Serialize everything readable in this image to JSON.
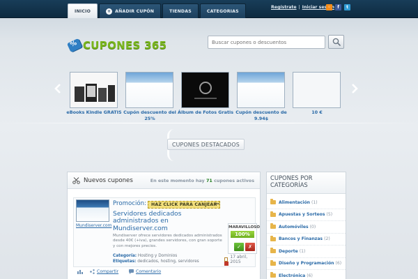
{
  "nav": {
    "items": [
      {
        "label": "INICIO"
      },
      {
        "label": "AÑADIR CUPÓN",
        "badge": "+"
      },
      {
        "label": "TIENDAS"
      },
      {
        "label": "CATEGORIAS"
      }
    ]
  },
  "user_links": {
    "register": "Regístrate",
    "separator": "|",
    "login": "Iniciar sesión"
  },
  "social": [
    {
      "icon": "rss-icon",
      "glyph": "◦",
      "color": "#f28c1a"
    },
    {
      "icon": "facebook-icon",
      "glyph": "f",
      "color": "#3b5998"
    },
    {
      "icon": "twitter-icon",
      "glyph": "t",
      "color": "#2f9bd4"
    }
  ],
  "logo": {
    "text": "CUPONES 365"
  },
  "search": {
    "placeholder": "Buscar cupones o descuentos"
  },
  "carousel": {
    "items": [
      {
        "caption": "eBooks Kindle GRATIS",
        "style": "t-kindle"
      },
      {
        "caption": "Cupón descuento del 25%",
        "style": "t-host"
      },
      {
        "caption": "Álbum de Fotos Gratis",
        "style": "t-wp"
      },
      {
        "caption": "Cupón descuento de 9.94$",
        "style": "t-host"
      },
      {
        "caption": "10 €",
        "style": "t-blank"
      }
    ]
  },
  "featured_label": "CUPONES DESTACADOS",
  "main": {
    "title": "Nuevos cupones",
    "count_prefix": "En este momento hay",
    "count": "71",
    "count_suffix": "cupones activos",
    "coupon": {
      "source": "Mundiserver.com",
      "promo_label": "Promoción:",
      "click_label": "HAZ CLICK PARA CANJEAR",
      "title": "Servidores dedicados administrados en Mundiserver.com",
      "description": "Mundiserver ofrece servidores dedicados administrados desde 40€ (+iva), grandes servidores, con gran soporte y con mejores precios.",
      "category_label": "Categoría:",
      "category_value": "Hosting y Dominios",
      "tags_label": "Etiquetas:",
      "tags_value": "dedicados, hosting, servidores",
      "date": "17 abril, 2015",
      "rating_label": "MARAVILLOSO",
      "rating_percent": "100%",
      "rating_fraction": 1.0
    },
    "footer": {
      "share": "Compartir",
      "comment": "Comentario"
    }
  },
  "sidebar": {
    "title": "CUPONES POR CATEGORÍAS",
    "categories": [
      {
        "name": "Alimentación",
        "count": "(1)"
      },
      {
        "name": "Apuestas y Sorteos",
        "count": "(5)"
      },
      {
        "name": "Automóviles",
        "count": "(0)"
      },
      {
        "name": "Bancos y Finanzas",
        "count": "(2)"
      },
      {
        "name": "Deporte",
        "count": "(1)"
      },
      {
        "name": "Diseño y Programación",
        "count": "(6)"
      },
      {
        "name": "Electrónica",
        "count": "(6)"
      }
    ]
  },
  "colors": {
    "nav_bg": "#183d59",
    "link": "#2a6aa7",
    "logo": "#79b51e",
    "rating": "#6fb01f"
  }
}
